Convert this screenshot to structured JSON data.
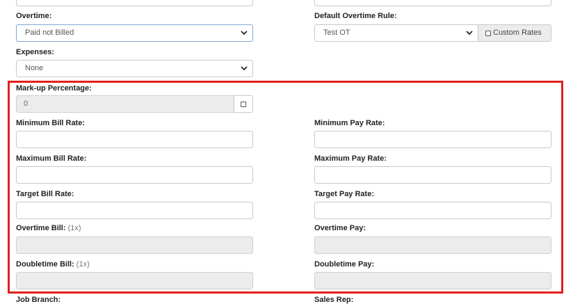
{
  "top": {
    "overtime": {
      "label": "Overtime:",
      "value": "Paid not Billed"
    },
    "default_overtime_rule": {
      "label": "Default Overtime Rule:",
      "value": "Test OT",
      "custom_rates_label": "Custom Rates"
    },
    "expenses": {
      "label": "Expenses:",
      "value": "None"
    }
  },
  "rates": {
    "markup": {
      "label": "Mark-up Percentage:",
      "value": "0"
    },
    "min_bill": {
      "label": "Minimum Bill Rate:",
      "value": ""
    },
    "min_pay": {
      "label": "Minimum Pay Rate:",
      "value": ""
    },
    "max_bill": {
      "label": "Maximum Bill Rate:",
      "value": ""
    },
    "max_pay": {
      "label": "Maximum Pay Rate:",
      "value": ""
    },
    "target_bill": {
      "label": "Target Bill Rate:",
      "value": ""
    },
    "target_pay": {
      "label": "Target Pay Rate:",
      "value": ""
    },
    "overtime_bill": {
      "label": "Overtime Bill:",
      "multiplier": "(1x)",
      "value": ""
    },
    "overtime_pay": {
      "label": "Overtime Pay:",
      "value": ""
    },
    "doubletime_bill": {
      "label": "Doubletime Bill:",
      "multiplier": "(1x)",
      "value": ""
    },
    "doubletime_pay": {
      "label": "Doubletime Pay:",
      "value": ""
    }
  },
  "bottom": {
    "job_branch": {
      "label": "Job Branch:"
    },
    "sales_rep": {
      "label": "Sales Rep:"
    }
  },
  "colors": {
    "highlight": "#e1201f",
    "disabled_bg": "#ececec",
    "focus_border": "#7fa8d6"
  }
}
